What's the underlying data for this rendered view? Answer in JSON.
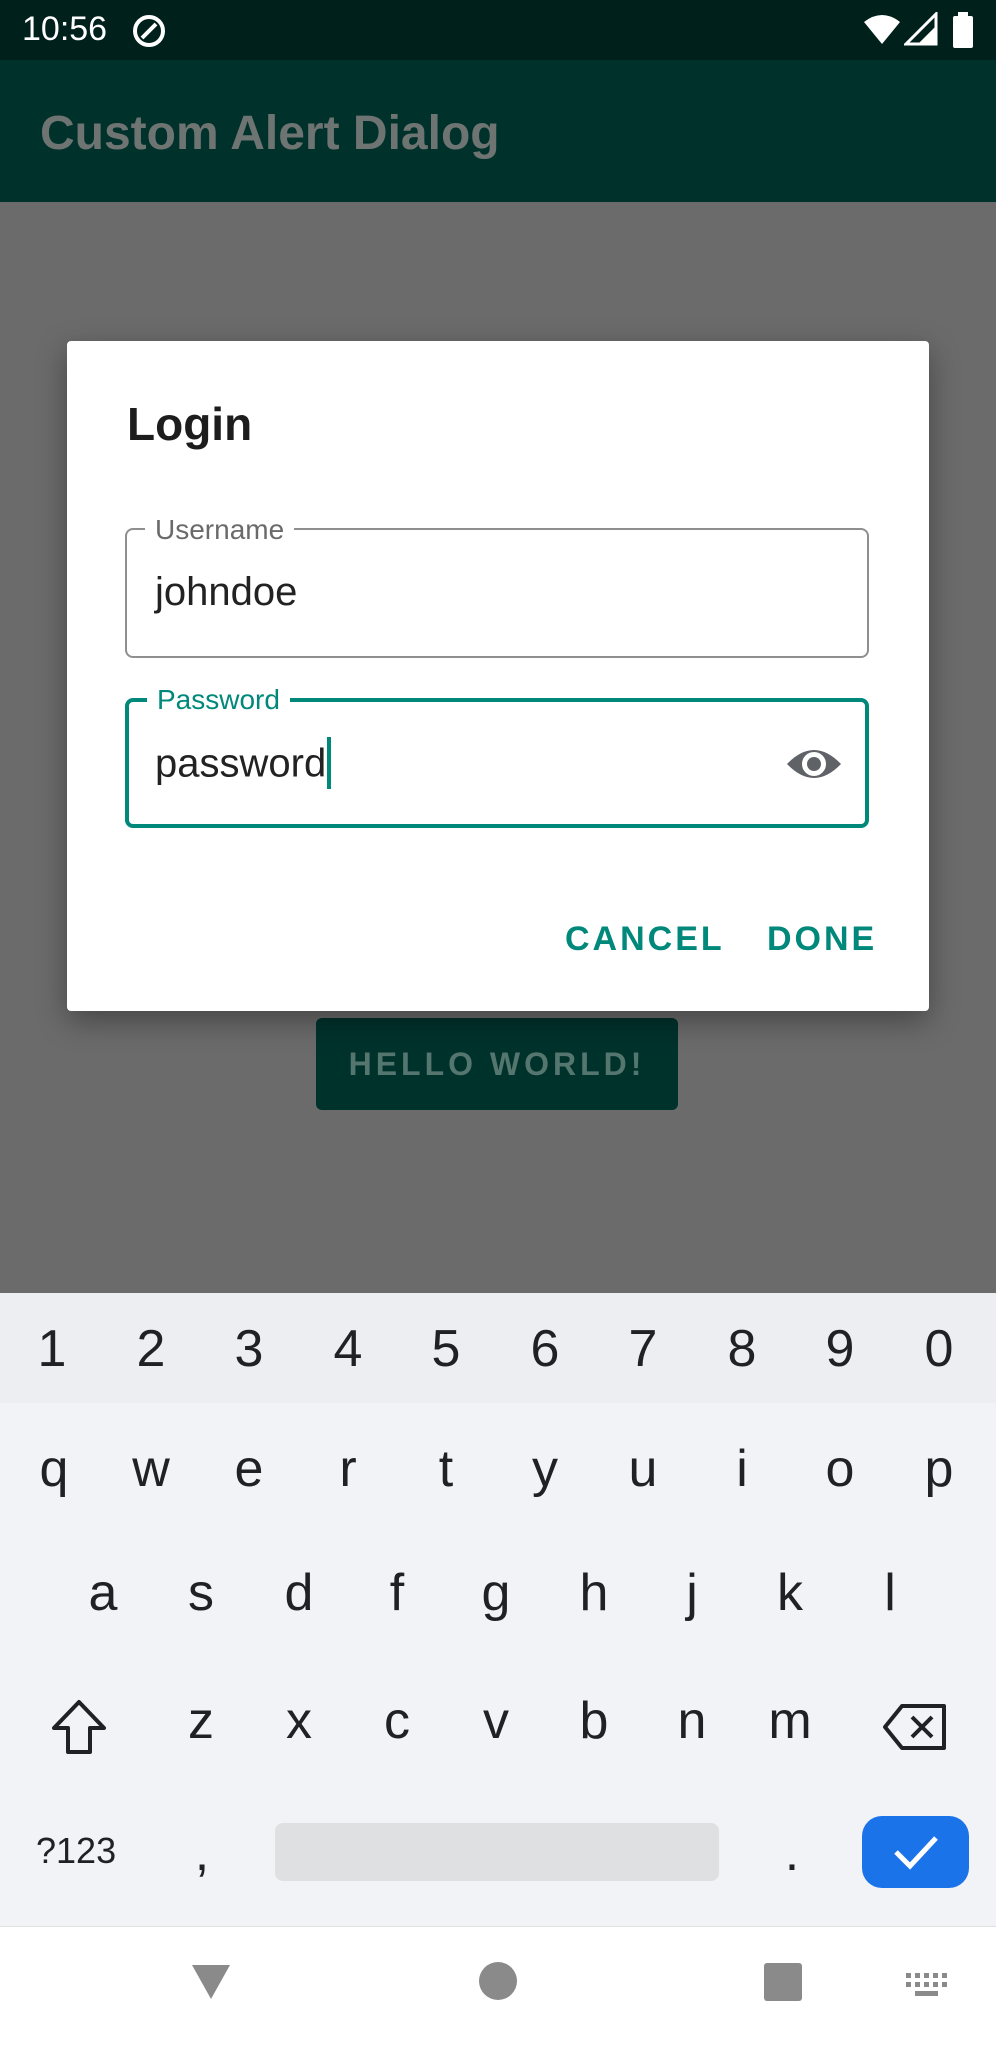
{
  "status_bar": {
    "time": "10:56"
  },
  "app_bar": {
    "title": "Custom Alert Dialog"
  },
  "background": {
    "button_label": "HELLO WORLD!"
  },
  "dialog": {
    "title": "Login",
    "username": {
      "label": "Username",
      "value": "johndoe"
    },
    "password": {
      "label": "Password",
      "value": "password"
    },
    "cancel_label": "CANCEL",
    "done_label": "DONE"
  },
  "keyboard": {
    "numbers": [
      "1",
      "2",
      "3",
      "4",
      "5",
      "6",
      "7",
      "8",
      "9",
      "0"
    ],
    "row1": [
      "q",
      "w",
      "e",
      "r",
      "t",
      "y",
      "u",
      "i",
      "o",
      "p"
    ],
    "row2": [
      "a",
      "s",
      "d",
      "f",
      "g",
      "h",
      "j",
      "k",
      "l"
    ],
    "row3": [
      "z",
      "x",
      "c",
      "v",
      "b",
      "n",
      "m"
    ],
    "symbols_label": "?123",
    "comma": ",",
    "period": "."
  },
  "colors": {
    "accent": "#00897b",
    "app_bar": "#00312b",
    "enter_key": "#1a73e8"
  },
  "icons": [
    "wifi-icon",
    "signal-icon",
    "battery-icon",
    "eye-icon",
    "shift-icon",
    "backspace-icon",
    "check-icon",
    "nav-back-icon",
    "nav-home-icon",
    "nav-recents-icon",
    "keyboard-icon"
  ]
}
